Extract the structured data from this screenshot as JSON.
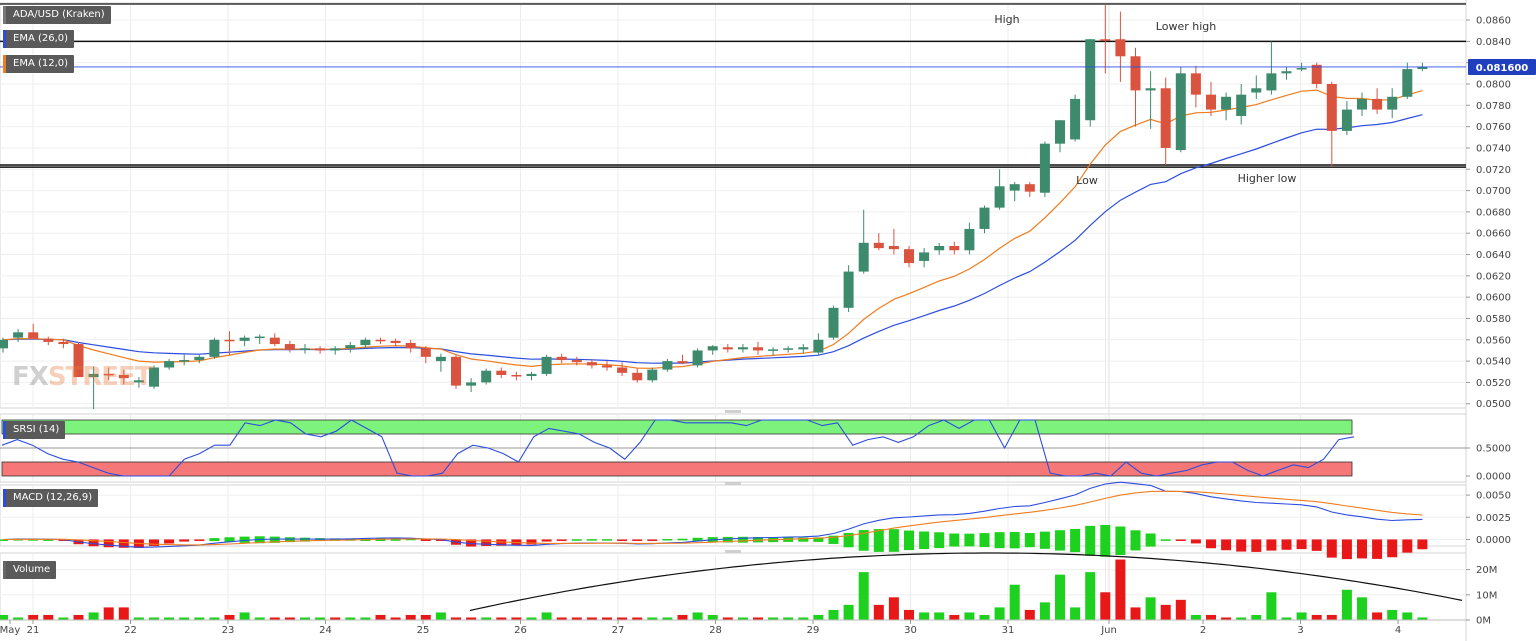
{
  "chart_data": {
    "type": "candlestick",
    "title": "ADA/USD (Kraken)",
    "current_price_label": "0.081600",
    "x_tick_labels": [
      "May",
      "21",
      "22",
      "23",
      "24",
      "25",
      "26",
      "27",
      "28",
      "29",
      "30",
      "31",
      "Jun",
      "2",
      "3",
      "4"
    ],
    "y_tick_labels": [
      "0.0860",
      "0.0840",
      "0.0820",
      "0.0800",
      "0.0780",
      "0.0760",
      "0.0740",
      "0.0720",
      "0.0700",
      "0.0680",
      "0.0660",
      "0.0640",
      "0.0620",
      "0.0600",
      "0.0580",
      "0.0560",
      "0.0540",
      "0.0520",
      "0.0500"
    ],
    "price_range": [
      0.0496,
      0.0876
    ],
    "horizontal_levels": [
      0.084,
      0.0724,
      0.0722
    ],
    "annotations": [
      "High",
      "Lower high",
      "Low",
      "Higher low"
    ],
    "candles": [
      [
        0.0552,
        0.0562,
        0.0548,
        0.056
      ],
      [
        0.0562,
        0.057,
        0.0558,
        0.0567
      ],
      [
        0.0567,
        0.0575,
        0.0564,
        0.0561
      ],
      [
        0.0561,
        0.0563,
        0.0555,
        0.0558
      ],
      [
        0.0558,
        0.0561,
        0.0552,
        0.0556
      ],
      [
        0.0556,
        0.0558,
        0.053,
        0.0525
      ],
      [
        0.0525,
        0.0535,
        0.0495,
        0.0528
      ],
      [
        0.0528,
        0.0534,
        0.0522,
        0.0527
      ],
      [
        0.0527,
        0.0532,
        0.0518,
        0.0524
      ],
      [
        0.052,
        0.0525,
        0.0515,
        0.0522
      ],
      [
        0.0516,
        0.0536,
        0.0514,
        0.0534
      ],
      [
        0.0534,
        0.0542,
        0.0532,
        0.054
      ],
      [
        0.054,
        0.0546,
        0.0536,
        0.0541
      ],
      [
        0.0541,
        0.0546,
        0.0538,
        0.0544
      ],
      [
        0.0544,
        0.0562,
        0.0542,
        0.056
      ],
      [
        0.056,
        0.0568,
        0.0546,
        0.0559
      ],
      [
        0.0559,
        0.0564,
        0.0554,
        0.0562
      ],
      [
        0.0562,
        0.0565,
        0.0556,
        0.0563
      ],
      [
        0.0562,
        0.0566,
        0.0554,
        0.0556
      ],
      [
        0.0556,
        0.0559,
        0.0548,
        0.0551
      ],
      [
        0.0551,
        0.0556,
        0.0547,
        0.0552
      ],
      [
        0.0552,
        0.0554,
        0.0547,
        0.055
      ],
      [
        0.055,
        0.0554,
        0.0546,
        0.0552
      ],
      [
        0.0552,
        0.0558,
        0.0548,
        0.0555
      ],
      [
        0.0555,
        0.0562,
        0.0552,
        0.056
      ],
      [
        0.056,
        0.0562,
        0.0556,
        0.0559
      ],
      [
        0.0559,
        0.0561,
        0.0554,
        0.0557
      ],
      [
        0.0557,
        0.056,
        0.0548,
        0.0552
      ],
      [
        0.0552,
        0.0554,
        0.0538,
        0.0544
      ],
      [
        0.054,
        0.0547,
        0.053,
        0.0544
      ],
      [
        0.0544,
        0.0546,
        0.0514,
        0.0517
      ],
      [
        0.0517,
        0.0524,
        0.0511,
        0.052
      ],
      [
        0.052,
        0.0533,
        0.0518,
        0.0531
      ],
      [
        0.0531,
        0.0534,
        0.0524,
        0.0527
      ],
      [
        0.0527,
        0.053,
        0.0522,
        0.0526
      ],
      [
        0.0526,
        0.053,
        0.0522,
        0.0528
      ],
      [
        0.0528,
        0.0546,
        0.0526,
        0.0544
      ],
      [
        0.0544,
        0.0547,
        0.0538,
        0.0541
      ],
      [
        0.0541,
        0.0544,
        0.0536,
        0.0539
      ],
      [
        0.0539,
        0.0542,
        0.0533,
        0.0536
      ],
      [
        0.0536,
        0.054,
        0.0531,
        0.0534
      ],
      [
        0.0534,
        0.0539,
        0.0526,
        0.0529
      ],
      [
        0.0529,
        0.0533,
        0.052,
        0.0522
      ],
      [
        0.0522,
        0.0534,
        0.052,
        0.0532
      ],
      [
        0.0532,
        0.0542,
        0.053,
        0.054
      ],
      [
        0.054,
        0.0546,
        0.0537,
        0.0538
      ],
      [
        0.0536,
        0.0552,
        0.0534,
        0.055
      ],
      [
        0.055,
        0.0555,
        0.0546,
        0.0554
      ],
      [
        0.0553,
        0.0556,
        0.0548,
        0.0551
      ],
      [
        0.0551,
        0.0556,
        0.0548,
        0.0553
      ],
      [
        0.0553,
        0.0558,
        0.0546,
        0.055
      ],
      [
        0.055,
        0.0553,
        0.0545,
        0.0551
      ],
      [
        0.0551,
        0.0554,
        0.0548,
        0.0552
      ],
      [
        0.0551,
        0.0556,
        0.0547,
        0.0553
      ],
      [
        0.0548,
        0.0566,
        0.0546,
        0.056
      ],
      [
        0.0562,
        0.0592,
        0.056,
        0.059
      ],
      [
        0.059,
        0.063,
        0.0586,
        0.0624
      ],
      [
        0.0624,
        0.0682,
        0.0622,
        0.0651
      ],
      [
        0.0651,
        0.066,
        0.0644,
        0.0646
      ],
      [
        0.0648,
        0.0664,
        0.064,
        0.0645
      ],
      [
        0.0645,
        0.0648,
        0.0628,
        0.0632
      ],
      [
        0.0634,
        0.0646,
        0.0628,
        0.0642
      ],
      [
        0.0644,
        0.0651,
        0.064,
        0.0648
      ],
      [
        0.0648,
        0.0652,
        0.064,
        0.0644
      ],
      [
        0.0644,
        0.067,
        0.064,
        0.0664
      ],
      [
        0.0664,
        0.0686,
        0.066,
        0.0684
      ],
      [
        0.0684,
        0.072,
        0.0682,
        0.0704
      ],
      [
        0.07,
        0.0708,
        0.069,
        0.0706
      ],
      [
        0.0706,
        0.0708,
        0.0694,
        0.0699
      ],
      [
        0.0698,
        0.0746,
        0.0694,
        0.0744
      ],
      [
        0.0744,
        0.0766,
        0.0736,
        0.0766
      ],
      [
        0.0748,
        0.079,
        0.0746,
        0.0786
      ],
      [
        0.0766,
        0.0842,
        0.076,
        0.0842
      ],
      [
        0.0842,
        0.0874,
        0.081,
        0.0841
      ],
      [
        0.0842,
        0.0868,
        0.0802,
        0.0826
      ],
      [
        0.0826,
        0.0834,
        0.076,
        0.0794
      ],
      [
        0.0794,
        0.0812,
        0.0758,
        0.0796
      ],
      [
        0.0796,
        0.0806,
        0.0724,
        0.074
      ],
      [
        0.0738,
        0.0816,
        0.0736,
        0.081
      ],
      [
        0.081,
        0.0817,
        0.0778,
        0.079
      ],
      [
        0.079,
        0.0802,
        0.077,
        0.0776
      ],
      [
        0.0776,
        0.0792,
        0.0766,
        0.0788
      ],
      [
        0.077,
        0.08,
        0.0762,
        0.079
      ],
      [
        0.0792,
        0.0808,
        0.0786,
        0.0796
      ],
      [
        0.0794,
        0.084,
        0.079,
        0.081
      ],
      [
        0.081,
        0.0816,
        0.0804,
        0.0812
      ],
      [
        0.0814,
        0.082,
        0.0812,
        0.0815
      ],
      [
        0.0818,
        0.082,
        0.0796,
        0.08
      ],
      [
        0.08,
        0.0802,
        0.0722,
        0.0756
      ],
      [
        0.0756,
        0.0784,
        0.0752,
        0.0776
      ],
      [
        0.0776,
        0.0792,
        0.077,
        0.0786
      ],
      [
        0.0786,
        0.0796,
        0.0772,
        0.0776
      ],
      [
        0.0776,
        0.0796,
        0.0768,
        0.0788
      ],
      [
        0.0788,
        0.082,
        0.0786,
        0.0814
      ],
      [
        0.0814,
        0.082,
        0.0812,
        0.0816
      ]
    ],
    "indicators": {
      "ema_long": {
        "name": "EMA (26,0)",
        "color": "#2d4de0"
      },
      "ema_short": {
        "name": "EMA (12,0)",
        "color": "#f07c1e"
      },
      "srsi": {
        "name": "SRSI (14)",
        "y_tick_labels": [
          "0.5000",
          "0.0000"
        ],
        "color": "#2d4de0",
        "values": [
          0.55,
          0.65,
          0.55,
          0.4,
          0.3,
          0.25,
          0.15,
          0.05,
          0.0,
          0.0,
          0.0,
          0.0,
          0.3,
          0.4,
          0.55,
          0.55,
          0.95,
          0.9,
          1.0,
          0.95,
          0.75,
          0.7,
          0.8,
          1.0,
          0.85,
          0.7,
          0.05,
          0.0,
          0.0,
          0.05,
          0.4,
          0.55,
          0.5,
          0.4,
          0.25,
          0.7,
          0.85,
          0.8,
          0.75,
          0.6,
          0.5,
          0.3,
          0.6,
          1.0,
          1.0,
          0.95,
          0.95,
          0.95,
          0.95,
          0.9,
          1.0,
          1.0,
          1.0,
          1.0,
          0.9,
          0.95,
          0.55,
          0.65,
          0.7,
          0.6,
          0.7,
          0.9,
          1.0,
          0.85,
          1.0,
          1.0,
          0.5,
          1.0,
          1.0,
          0.05,
          0.0,
          0.0,
          0.05,
          0.0,
          0.25,
          0.05,
          0.0,
          0.05,
          0.1,
          0.2,
          0.25,
          0.25,
          0.1,
          0.0,
          0.1,
          0.2,
          0.15,
          0.3,
          0.65,
          0.7
        ]
      },
      "macd": {
        "name": "MACD (12,26,9)",
        "y_tick_labels": [
          "0.0050",
          "0.0025",
          "0.0000"
        ],
        "macd_color": "#2d4de0",
        "signal_color": "#f07c1e"
      },
      "volume": {
        "name": "Volume",
        "y_tick_labels": [
          "20M",
          "10M",
          "0M"
        ],
        "values": [
          2,
          1,
          2,
          2,
          1,
          2,
          3,
          5,
          5,
          1,
          1,
          1,
          1,
          1,
          1,
          2,
          3,
          1,
          1,
          1,
          1,
          1,
          1,
          1,
          1,
          2,
          1,
          2,
          2,
          3,
          1,
          1,
          1,
          1,
          1,
          1,
          3,
          1,
          1,
          1,
          1,
          1,
          1,
          1,
          1,
          2,
          3,
          2,
          1,
          1,
          1,
          1,
          1,
          1,
          2,
          4,
          6,
          19,
          6,
          9,
          4,
          3,
          3,
          2,
          3,
          2,
          5,
          14,
          4,
          7,
          18,
          5,
          19,
          11,
          24,
          5,
          9,
          6,
          8,
          2,
          2,
          1,
          1,
          2,
          11,
          1,
          3,
          2,
          2,
          12,
          9,
          3,
          4,
          3,
          1
        ],
        "up": [
          1,
          1,
          0,
          0,
          1,
          0,
          1,
          0,
          0,
          1,
          1,
          1,
          1,
          1,
          1,
          0,
          1,
          1,
          0,
          0,
          1,
          1,
          0,
          1,
          1,
          0,
          0,
          0,
          0,
          1,
          0,
          0,
          1,
          0,
          0,
          1,
          1,
          0,
          0,
          0,
          0,
          0,
          0,
          1,
          1,
          0,
          1,
          1,
          0,
          1,
          0,
          1,
          1,
          1,
          1,
          1,
          1,
          1,
          0,
          0,
          0,
          1,
          1,
          0,
          1,
          1,
          1,
          1,
          0,
          1,
          1,
          1,
          1,
          0,
          0,
          0,
          1,
          0,
          0,
          1,
          0,
          0,
          1,
          1,
          1,
          1,
          1,
          0,
          0,
          1,
          1,
          0,
          1,
          1,
          1
        ]
      }
    }
  }
}
